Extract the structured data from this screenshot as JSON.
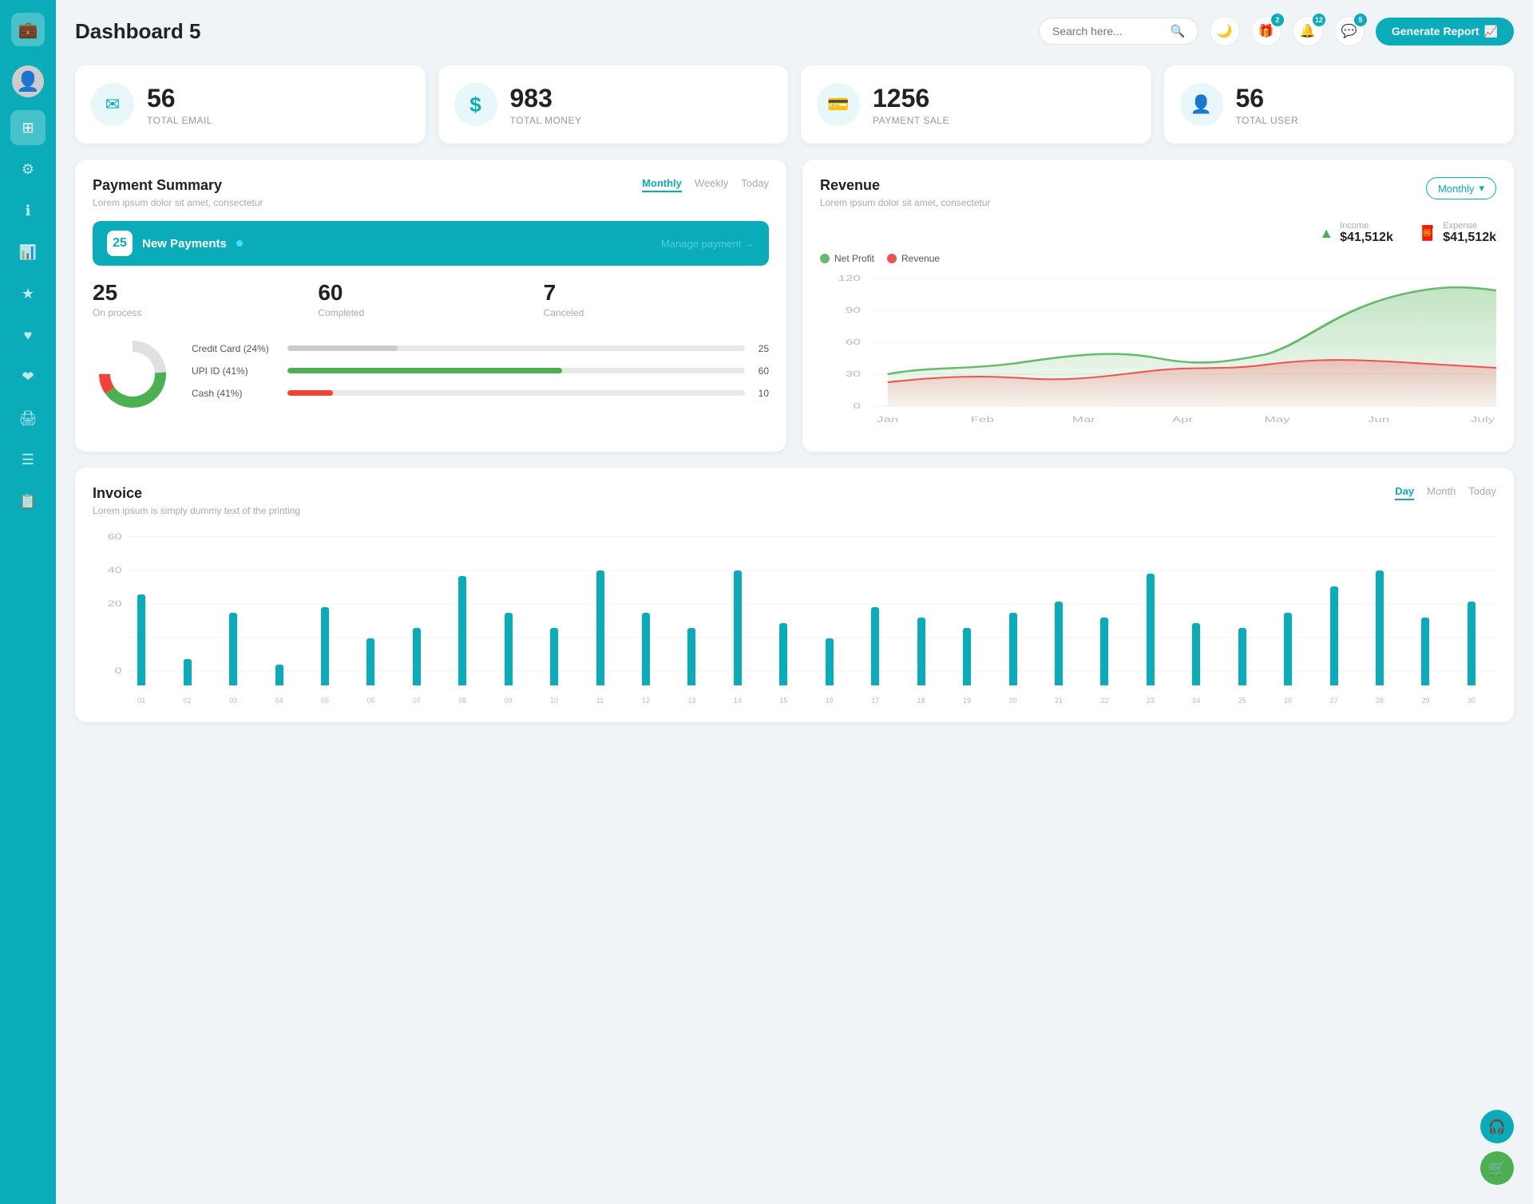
{
  "app": {
    "title": "Dashboard 5"
  },
  "header": {
    "search_placeholder": "Search here...",
    "badge_gift": "2",
    "badge_bell": "12",
    "badge_chat": "5",
    "generate_btn": "Generate Report"
  },
  "stats": [
    {
      "id": "total-email",
      "number": "56",
      "label": "TOTAL EMAIL",
      "icon": "✉"
    },
    {
      "id": "total-money",
      "number": "983",
      "label": "TOTAL MONEY",
      "icon": "$"
    },
    {
      "id": "payment-sale",
      "number": "1256",
      "label": "PAYMENT SALE",
      "icon": "💳"
    },
    {
      "id": "total-user",
      "number": "56",
      "label": "TOTAL USER",
      "icon": "👤"
    }
  ],
  "payment_summary": {
    "title": "Payment Summary",
    "subtitle": "Lorem ipsum dolor sit amet, consectetur",
    "tabs": [
      "Monthly",
      "Weekly",
      "Today"
    ],
    "active_tab": "Monthly",
    "new_payments_count": "25",
    "new_payments_label": "New Payments",
    "manage_payment": "Manage payment →",
    "on_process": "25",
    "on_process_label": "On process",
    "completed": "60",
    "completed_label": "Completed",
    "canceled": "7",
    "canceled_label": "Canceled",
    "breakdown": [
      {
        "label": "Credit Card (24%)",
        "percent": 24,
        "value": "25",
        "color": "#ccc"
      },
      {
        "label": "UPI ID (41%)",
        "percent": 60,
        "value": "60",
        "color": "#4caf50"
      },
      {
        "label": "Cash (41%)",
        "percent": 10,
        "value": "10",
        "color": "#f44336"
      }
    ]
  },
  "revenue": {
    "title": "Revenue",
    "subtitle": "Lorem ipsum dolor sit amet, consectetur",
    "active_tab": "Monthly",
    "tabs": [
      "Monthly"
    ],
    "income_label": "Income",
    "income_val": "$41,512k",
    "expense_label": "Expense",
    "expense_val": "$41,512k",
    "legend": [
      {
        "label": "Net Profit",
        "color": "#66bb6a"
      },
      {
        "label": "Revenue",
        "color": "#ef5350"
      }
    ],
    "x_labels": [
      "Jan",
      "Feb",
      "Mar",
      "Apr",
      "May",
      "Jun",
      "July"
    ],
    "y_labels": [
      "120",
      "90",
      "60",
      "30",
      "0"
    ]
  },
  "invoice": {
    "title": "Invoice",
    "subtitle": "Lorem ipsum is simply dummy text of the printing",
    "tabs": [
      "Day",
      "Month",
      "Today"
    ],
    "active_tab": "Day",
    "y_labels": [
      "60",
      "40",
      "20",
      "0"
    ],
    "x_labels": [
      "01",
      "02",
      "03",
      "04",
      "05",
      "06",
      "07",
      "08",
      "09",
      "10",
      "11",
      "12",
      "13",
      "14",
      "15",
      "16",
      "17",
      "18",
      "19",
      "20",
      "21",
      "22",
      "23",
      "24",
      "25",
      "26",
      "27",
      "28",
      "29",
      "30"
    ],
    "bars": [
      35,
      10,
      28,
      8,
      30,
      18,
      22,
      42,
      28,
      22,
      44,
      28,
      22,
      44,
      24,
      18,
      30,
      26,
      22,
      28,
      32,
      26,
      43,
      24,
      22,
      28,
      38,
      44,
      26,
      32
    ]
  },
  "sidebar": {
    "items": [
      {
        "id": "wallet",
        "icon": "💼",
        "active": true
      },
      {
        "id": "dashboard",
        "icon": "⊞",
        "active": true
      },
      {
        "id": "settings",
        "icon": "⚙",
        "active": false
      },
      {
        "id": "info",
        "icon": "ℹ",
        "active": false
      },
      {
        "id": "chart",
        "icon": "📊",
        "active": false
      },
      {
        "id": "star",
        "icon": "★",
        "active": false
      },
      {
        "id": "favorite",
        "icon": "♥",
        "active": false
      },
      {
        "id": "heart2",
        "icon": "❤",
        "active": false
      },
      {
        "id": "print",
        "icon": "🖨",
        "active": false
      },
      {
        "id": "menu",
        "icon": "☰",
        "active": false
      },
      {
        "id": "docs",
        "icon": "📋",
        "active": false
      }
    ]
  }
}
